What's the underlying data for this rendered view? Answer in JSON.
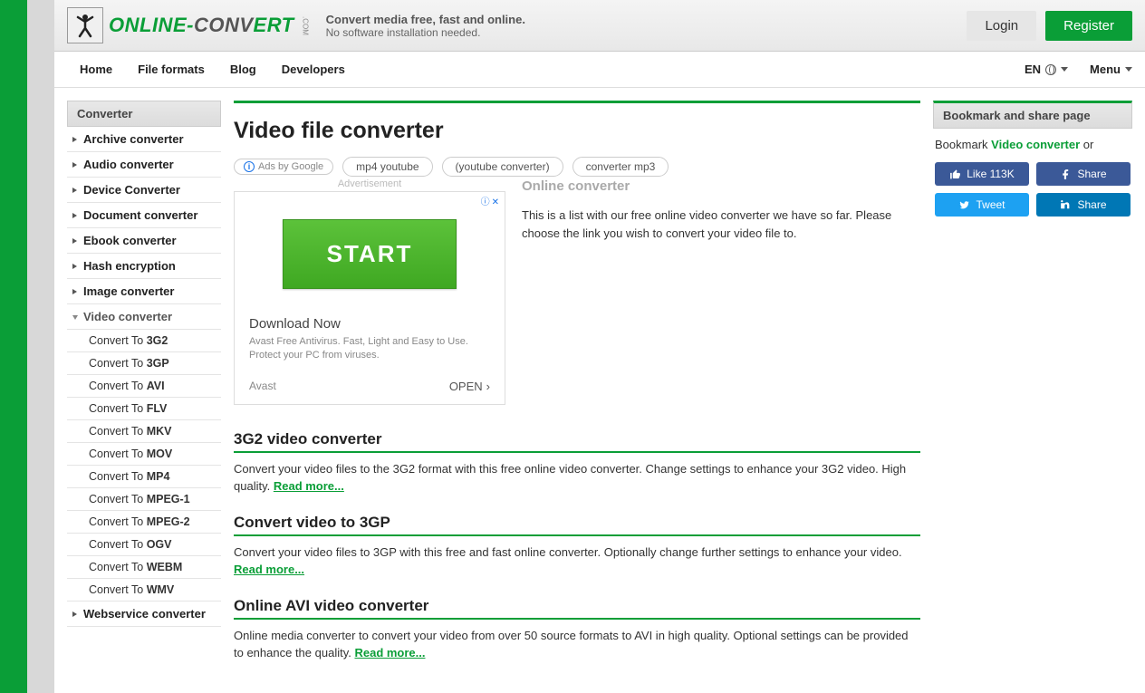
{
  "header": {
    "logo_part1": "ONLINE-",
    "logo_part2": "CONV",
    "logo_part3": "ERT",
    "logo_suffix": ".COM",
    "tagline1": "Convert media free, fast and online.",
    "tagline2": "No software installation needed.",
    "login": "Login",
    "register": "Register"
  },
  "nav": {
    "items": [
      "Home",
      "File formats",
      "Blog",
      "Developers"
    ],
    "lang": "EN",
    "menu": "Menu"
  },
  "sidebar": {
    "heading": "Converter",
    "items": [
      {
        "label": "Archive converter"
      },
      {
        "label": "Audio converter"
      },
      {
        "label": "Device Converter"
      },
      {
        "label": "Document converter"
      },
      {
        "label": "Ebook converter"
      },
      {
        "label": "Hash encryption"
      },
      {
        "label": "Image converter"
      },
      {
        "label": "Video converter",
        "open": true
      },
      {
        "label": "Webservice converter"
      }
    ],
    "video_sub_prefix": "Convert To ",
    "video_sub": [
      "3G2",
      "3GP",
      "AVI",
      "FLV",
      "MKV",
      "MOV",
      "MP4",
      "MPEG-1",
      "MPEG-2",
      "OGV",
      "WEBM",
      "WMV"
    ]
  },
  "content": {
    "title": "Video file converter",
    "ad_label": "Ads by Google",
    "ad_chips": [
      "mp4 youtube",
      "(youtube converter)",
      "converter mp3"
    ],
    "advertisement": "Advertisement",
    "ad_start": "START",
    "ad_dl": "Download Now",
    "ad_txt": "Avast Free Antivirus. Fast, Light and Easy to Use. Protect your PC from viruses.",
    "ad_brand": "Avast",
    "ad_open": "OPEN",
    "intro_h": "Online converter",
    "intro_p": "This is a list with our free online video converter we have so far. Please choose the link you wish to convert your video file to.",
    "sections": [
      {
        "h": "3G2 video converter",
        "p": "Convert your video files to the 3G2 format with this free online video converter. Change settings to enhance your 3G2 video. High quality. ",
        "a": "Read more..."
      },
      {
        "h": "Convert video to 3GP",
        "p": "Convert your video files to 3GP with this free and fast online converter. Optionally change further settings to enhance your video. ",
        "a": "Read more..."
      },
      {
        "h": "Online AVI video converter",
        "p": "Online media converter to convert your video from over 50 source formats to AVI in high quality. Optional settings can be provided to enhance the quality. ",
        "a": "Read more..."
      }
    ]
  },
  "right": {
    "heading": "Bookmark and share page",
    "bookmark_pre": "Bookmark ",
    "bookmark_link": "Video converter",
    "bookmark_post": " or",
    "like": "Like 113K",
    "share": "Share",
    "tweet": "Tweet",
    "share2": "Share"
  }
}
